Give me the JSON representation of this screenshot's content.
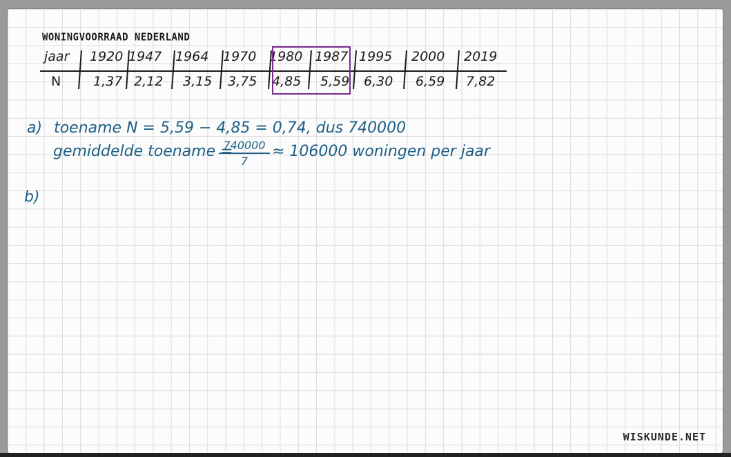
{
  "document": {
    "title": "WONINGVOORRAAD NEDERLAND",
    "brand": "WISKUNDE.NET"
  },
  "table": {
    "row_labels": [
      "jaar",
      "N"
    ],
    "years": [
      "1920",
      "1947",
      "1964",
      "1970",
      "1980",
      "1987",
      "1995",
      "2000",
      "2019"
    ],
    "values": [
      "1,37",
      "2,12",
      "3,15",
      "3,75",
      "4,85",
      "5,59",
      "6,30",
      "6,59",
      "7,82"
    ],
    "highlight_color": "#7a2a8f"
  },
  "answers": {
    "a_label": "a)",
    "a_line1": "toename N = 5,59 − 4,85 = 0,74, dus 740000",
    "a_line2_prefix": "gemiddelde toename =",
    "a_fraction_numerator": "740000",
    "a_fraction_denominator": "7",
    "a_line2_suffix": "≈ 106000 woningen per jaar",
    "b_label": "b)"
  },
  "colors": {
    "ink": "#1d5f86",
    "pencil": "#1a1a1a",
    "grid": "#dcdcdc"
  }
}
